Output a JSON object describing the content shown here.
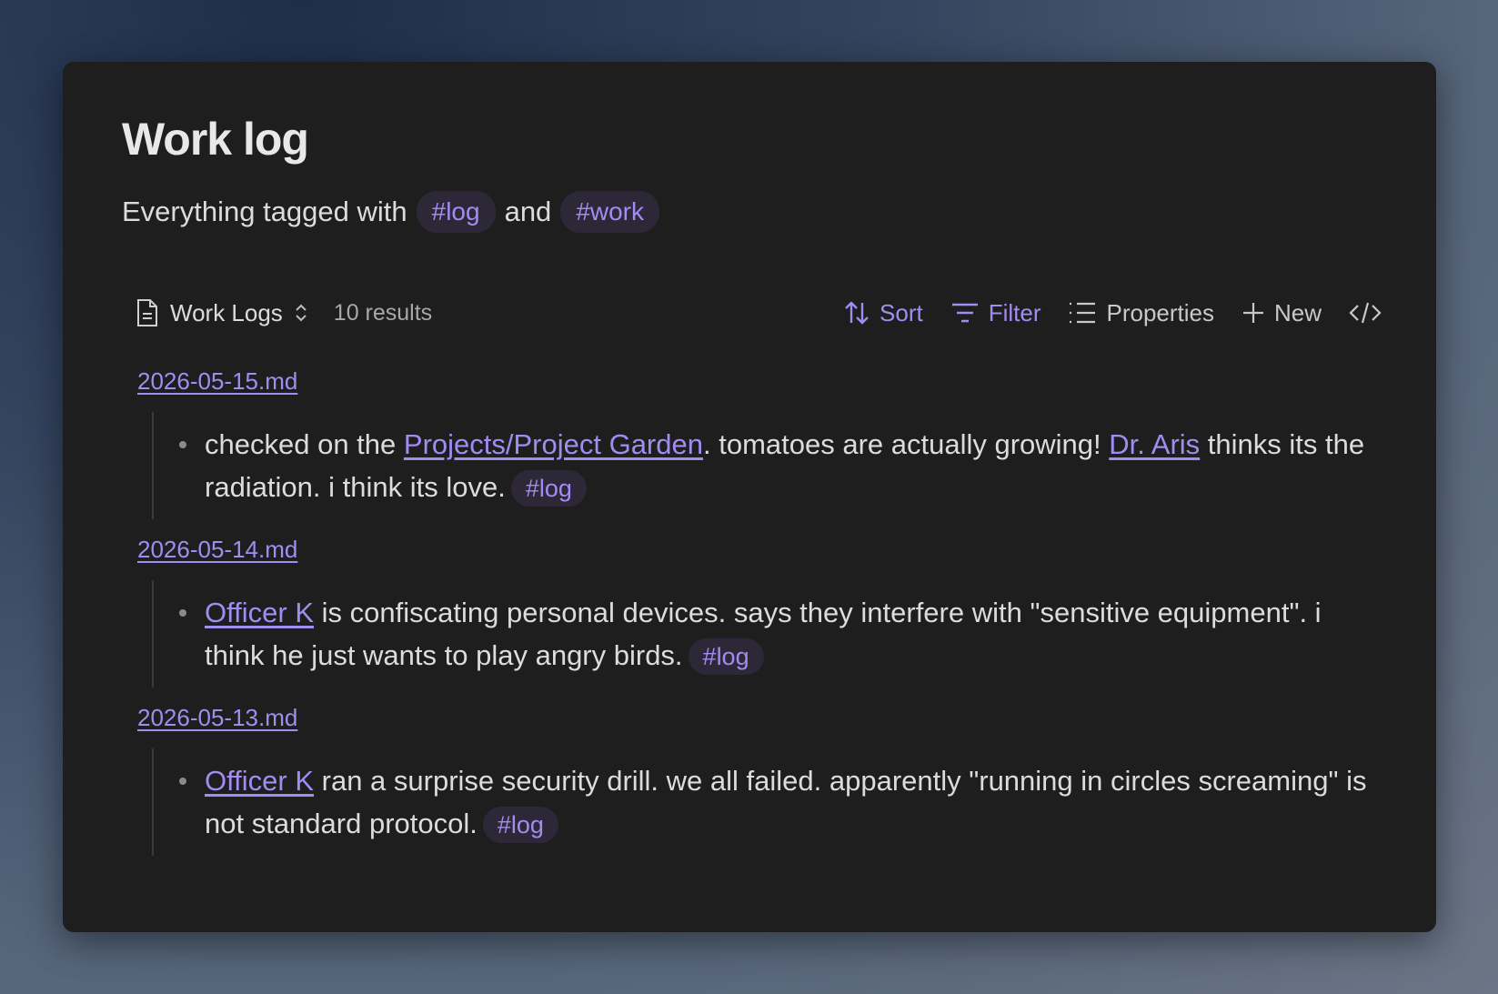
{
  "page": {
    "title": "Work log",
    "subtitle_prefix": "Everything tagged with",
    "subtitle_tag1": "#log",
    "subtitle_and": "and",
    "subtitle_tag2": "#work"
  },
  "toolbar": {
    "view_name": "Work Logs",
    "results": "10 results",
    "sort": "Sort",
    "filter": "Filter",
    "properties": "Properties",
    "new": "New"
  },
  "groups": [
    {
      "file": "2026-05-15.md",
      "parts": {
        "t1": "checked on the ",
        "l1": "Projects/Project Garden",
        "t2": ". tomatoes are actually growing! ",
        "l2": "Dr. Aris",
        "t3": " thinks its the radiation. i think its love.",
        "tag": "#log"
      }
    },
    {
      "file": "2026-05-14.md",
      "parts": {
        "l1": "Officer K",
        "t1": " is confiscating personal devices. says they interfere with \"sensitive equipment\". i think he just wants to play angry birds.",
        "tag": "#log"
      }
    },
    {
      "file": "2026-05-13.md",
      "parts": {
        "l1": "Officer K",
        "t1": " ran a surprise security drill. we all failed. apparently \"running in circles screaming\" is not standard protocol.",
        "tag": "#log"
      }
    }
  ],
  "colors": {
    "accent": "#a18cf0",
    "panel": "#1e1e1e",
    "text": "#dcdcdc"
  }
}
